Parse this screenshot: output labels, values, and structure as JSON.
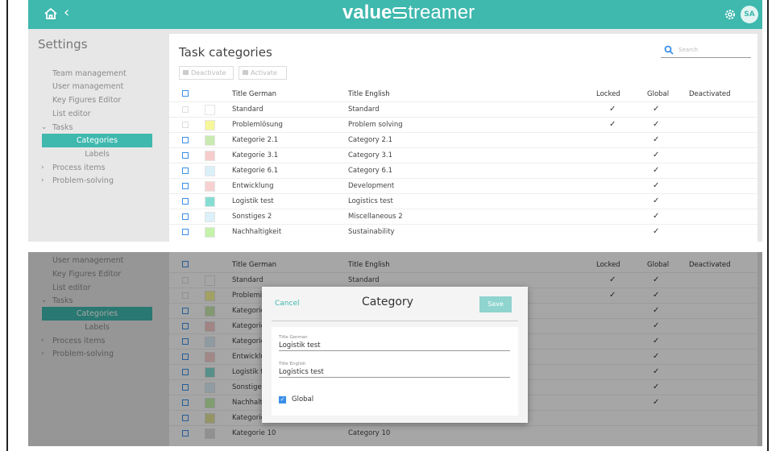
{
  "app": {
    "logo_bold": "value",
    "logo_light": "treamer",
    "avatar": "SA"
  },
  "icons": {
    "home": "home-icon",
    "back": "chevron-left-icon",
    "gear": "gear-icon",
    "search": "search-icon"
  },
  "colors": {
    "accent": "#3fb8ae",
    "checkbox": "#3a8fe8"
  },
  "sidebar": {
    "title": "Settings",
    "items": [
      {
        "label": "Team management"
      },
      {
        "label": "User management"
      },
      {
        "label": "Key Figures Editor"
      },
      {
        "label": "List editor"
      },
      {
        "label": "Tasks",
        "expanded": true
      },
      {
        "label": "Categories",
        "active": true
      },
      {
        "label": "Labels"
      },
      {
        "label": "Process items"
      },
      {
        "label": "Problem-solving"
      }
    ]
  },
  "main": {
    "title": "Task categories",
    "search_placeholder": "Search",
    "deactivate_label": "Deactivate",
    "activate_label": "Activate",
    "columns": {
      "german": "Title German",
      "english": "Title English",
      "locked": "Locked",
      "global": "Global",
      "deactivated": "Deactivated"
    },
    "rows": [
      {
        "de": "Standard",
        "en": "Standard",
        "color": "#ffffff",
        "locked": true,
        "global": true,
        "selectable": false
      },
      {
        "de": "Problemlösung",
        "en": "Problem solving",
        "color": "#f7f79a",
        "locked": true,
        "global": true,
        "selectable": false
      },
      {
        "de": "Kategorie 2.1",
        "en": "Category 2.1",
        "color": "#c9ebb0",
        "locked": false,
        "global": true,
        "selectable": true
      },
      {
        "de": "Kategorie 3.1",
        "en": "Category 3.1",
        "color": "#f7cccc",
        "locked": false,
        "global": true,
        "selectable": true
      },
      {
        "de": "Kategorie 6.1",
        "en": "Category 6.1",
        "color": "#daf0f9",
        "locked": false,
        "global": true,
        "selectable": true
      },
      {
        "de": "Entwicklung",
        "en": "Development",
        "color": "#f9d0d0",
        "locked": false,
        "global": true,
        "selectable": true
      },
      {
        "de": "Logistik test",
        "en": "Logistics test",
        "color": "#86ddd4",
        "locked": false,
        "global": true,
        "selectable": true
      },
      {
        "de": "Sonstiges 2",
        "en": "Miscellaneous 2",
        "color": "#dcf1f9",
        "locked": false,
        "global": true,
        "selectable": true
      },
      {
        "de": "Nachhaltigkeit",
        "en": "Sustainability",
        "color": "#c4f2aa",
        "locked": false,
        "global": true,
        "selectable": true
      }
    ],
    "extra_rows": [
      {
        "de": "Kategorie",
        "en": "",
        "color": "#e4e49c",
        "global": false
      },
      {
        "de": "Kategorie 10",
        "en": "Category 10",
        "color": "#dddddd",
        "global": false
      }
    ],
    "truncated_de": [
      "Standard",
      "Problemi",
      "Kategorie",
      "Kategorie",
      "Kategorie",
      "Entwicklu",
      "Logistik t",
      "Sonstige",
      "Nachhalt"
    ]
  },
  "dialog": {
    "cancel": "Cancel",
    "title": "Category",
    "save": "Save",
    "german_label": "Title German",
    "german_value": "Logistik test",
    "english_label": "Title English",
    "english_value": "Logistics test",
    "global_label": "Global",
    "global_checked": true
  }
}
